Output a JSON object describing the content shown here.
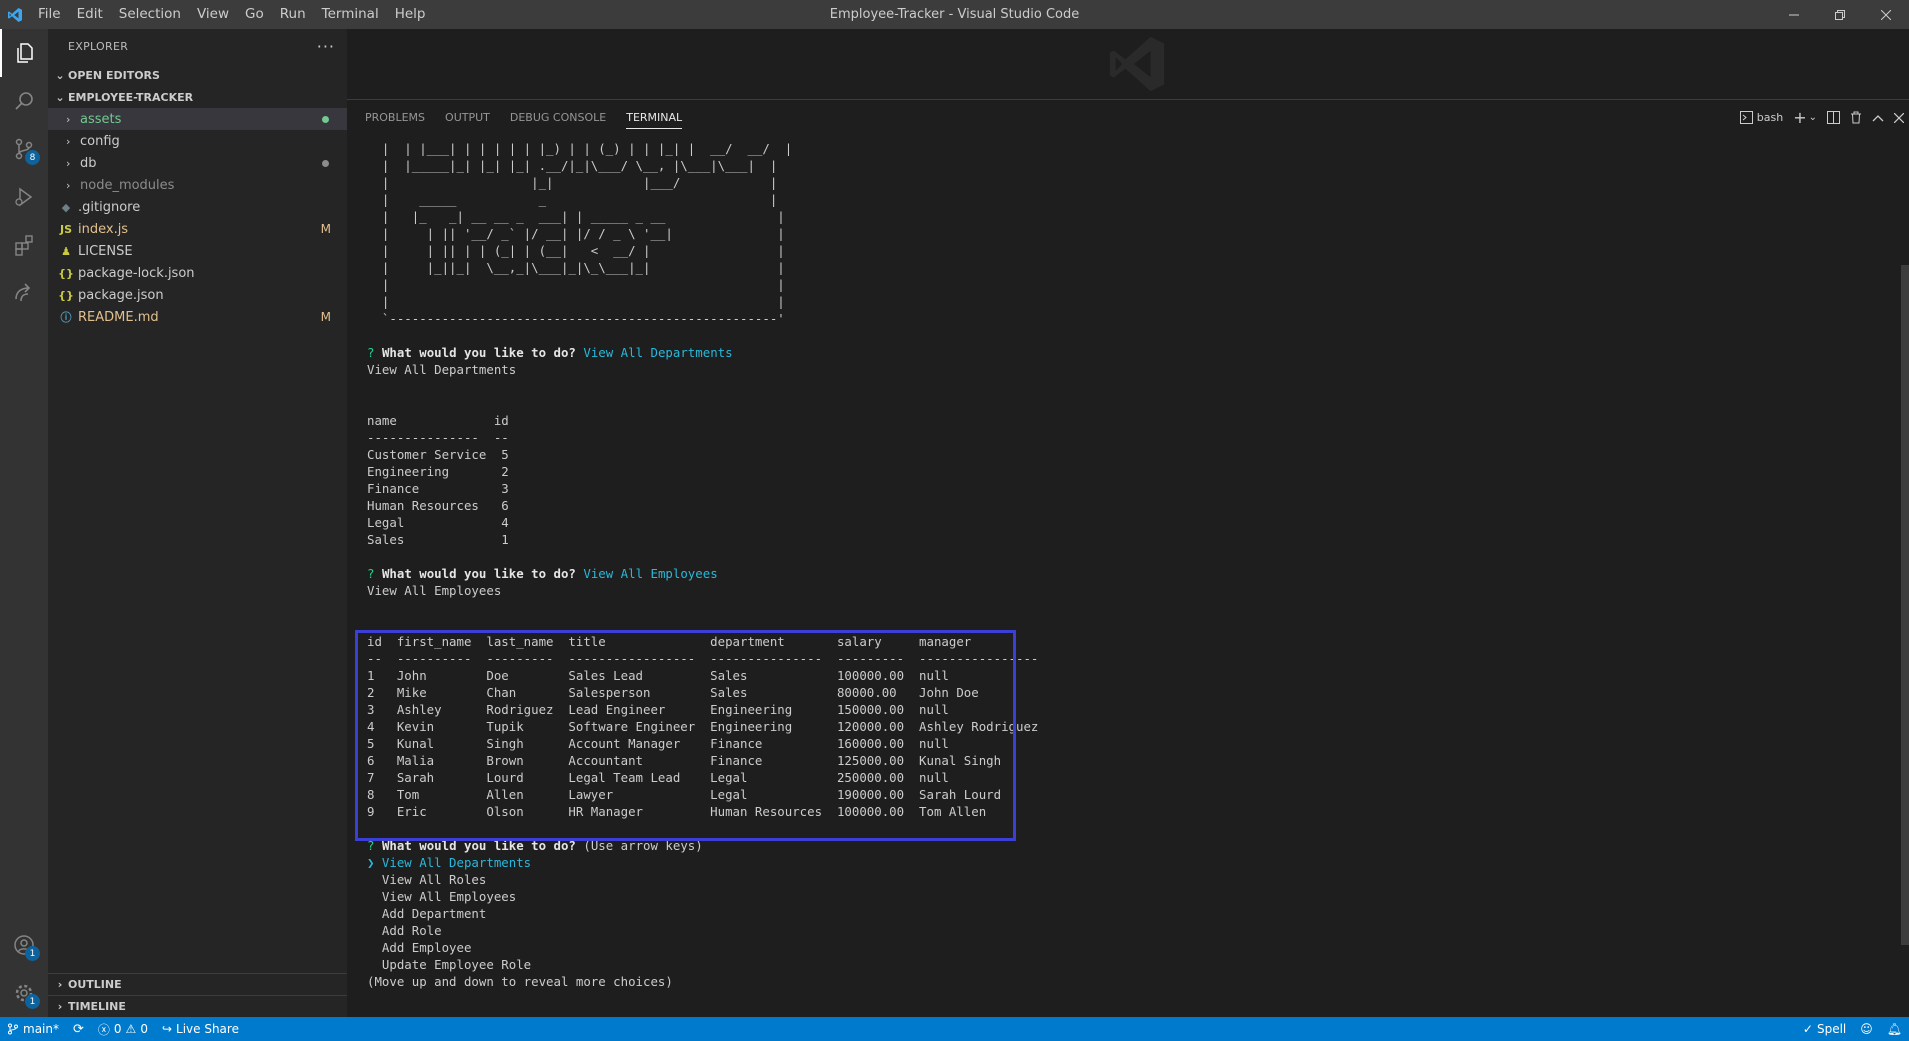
{
  "window": {
    "title": "Employee-Tracker - Visual Studio Code",
    "menu": [
      "File",
      "Edit",
      "Selection",
      "View",
      "Go",
      "Run",
      "Terminal",
      "Help"
    ]
  },
  "activity_bar": {
    "scm_badge": "8",
    "accounts_badge": "1",
    "settings_badge": "1"
  },
  "sidebar": {
    "header": "EXPLORER",
    "open_editors": "OPEN EDITORS",
    "folder": "EMPLOYEE-TRACKER",
    "items": [
      {
        "label": "assets",
        "type": "folder",
        "color": "#73c991",
        "decoration": "dot"
      },
      {
        "label": "config",
        "type": "folder",
        "color": "#cccccc",
        "decoration": ""
      },
      {
        "label": "db",
        "type": "folder",
        "color": "#cccccc",
        "decoration": "dot"
      },
      {
        "label": "node_modules",
        "type": "folder",
        "color": "#8c8c8c",
        "decoration": ""
      },
      {
        "label": ".gitignore",
        "type": "file",
        "icon": "◆",
        "color": "#cccccc",
        "decoration": ""
      },
      {
        "label": "index.js",
        "type": "file",
        "icon": "JS",
        "color": "#e2c08d",
        "decoration": "M"
      },
      {
        "label": "LICENSE",
        "type": "file",
        "icon": "♟",
        "color": "#cccccc",
        "decoration": ""
      },
      {
        "label": "package-lock.json",
        "type": "file",
        "icon": "{}",
        "color": "#cccccc",
        "decoration": ""
      },
      {
        "label": "package.json",
        "type": "file",
        "icon": "{}",
        "color": "#cccccc",
        "decoration": ""
      },
      {
        "label": "README.md",
        "type": "file",
        "icon": "ⓘ",
        "color": "#e2c08d",
        "decoration": "M"
      }
    ],
    "outline": "OUTLINE",
    "timeline": "TIMELINE"
  },
  "panel": {
    "tabs": [
      "PROBLEMS",
      "OUTPUT",
      "DEBUG CONSOLE",
      "TERMINAL"
    ],
    "active_tab": "TERMINAL",
    "shell": "bash"
  },
  "terminal": {
    "ascii_art": "  |  | |___| | | | | | |_) | | (_) | | |_| |  __/  __/  |\n  |  |_____|_| |_| |_| .__/|_|\\___/ \\__, |\\___|\\___|  |\n  |                   |_|            |___/            |\n  |    _____           _                              |\n  |   |_   _| __ __ _  ___| | _____ _ __               |\n  |     | || '__/ _` |/ __| |/ / _ \\ '__|              |\n  |     | || | | (_| | (__|   <  __/ |                 |\n  |     |_||_|  \\__,_|\\___|_|\\_\\___|_|                 |\n  |                                                    |\n  |                                                    |\n  `----------------------------------------------------'",
    "prompt1": {
      "q": "?",
      "question": "What would you like to do?",
      "answer": "View All Departments"
    },
    "echo1": "View All Departments",
    "dept_header": "name             id",
    "dept_sep": "---------------  --",
    "departments": [
      "Customer Service  5",
      "Engineering       2",
      "Finance           3",
      "Human Resources   6",
      "Legal             4",
      "Sales             1"
    ],
    "prompt2": {
      "q": "?",
      "question": "What would you like to do?",
      "answer": "View All Employees"
    },
    "echo2": "View All Employees",
    "emp_header": "id  first_name  last_name  title              department       salary     manager",
    "emp_sep": "--  ----------  ---------  -----------------  ---------------  ---------  ----------------",
    "employees": [
      "1   John        Doe        Sales Lead         Sales            100000.00  null",
      "2   Mike        Chan       Salesperson        Sales            80000.00   John Doe",
      "3   Ashley      Rodriguez  Lead Engineer      Engineering      150000.00  null",
      "4   Kevin       Tupik      Software Engineer  Engineering      120000.00  Ashley Rodriguez",
      "5   Kunal       Singh      Account Manager    Finance          160000.00  null",
      "6   Malia       Brown      Accountant         Finance          125000.00  Kunal Singh",
      "7   Sarah       Lourd      Legal Team Lead    Legal            250000.00  null",
      "8   Tom         Allen      Lawyer             Legal            190000.00  Sarah Lourd",
      "9   Eric        Olson      HR Manager         Human Resources  100000.00  Tom Allen"
    ],
    "prompt3": {
      "q": "?",
      "question": "What would you like to do?",
      "hint": "(Use arrow keys)"
    },
    "choices_selected": "❯ View All Departments",
    "choices": [
      "  View All Roles",
      "  View All Employees",
      "  Add Department",
      "  Add Role",
      "  Add Employee",
      "  Update Employee Role"
    ],
    "footer": "(Move up and down to reveal more choices)"
  },
  "statusbar": {
    "branch": "main*",
    "errors": "0",
    "warnings": "0",
    "live_share": "Live Share",
    "spell": "Spell"
  },
  "colors": {
    "accent": "#007acc",
    "highlight_box": "#3b3fd6",
    "prompt_answer": "#29b8db"
  }
}
